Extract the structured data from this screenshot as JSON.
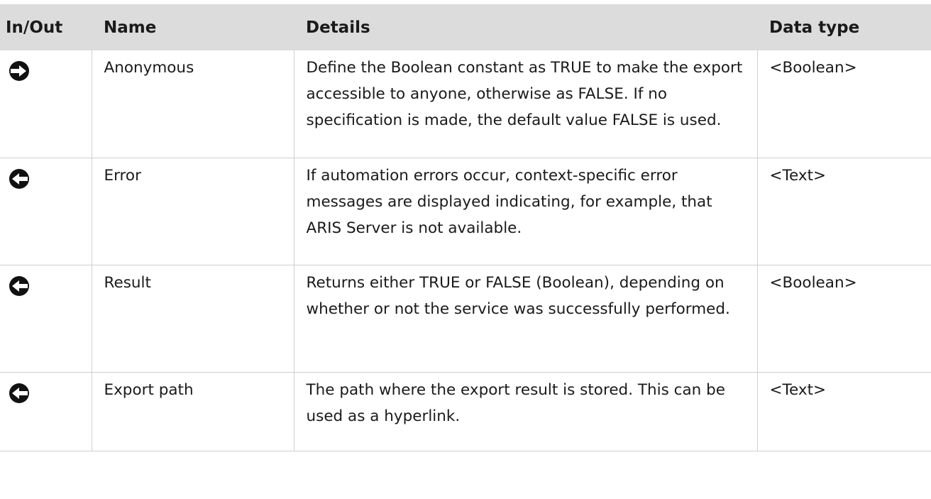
{
  "headers": {
    "inout": "In/Out",
    "name": "Name",
    "details": "Details",
    "datatype": "Data type"
  },
  "rows": [
    {
      "direction_icon": "input-arrow-icon",
      "name": "Anonymous",
      "details": "Define the Boolean constant as TRUE to make the export accessible to anyone, otherwise as FALSE. If no specification is made, the default value FALSE is used.",
      "datatype": "<Boolean>"
    },
    {
      "direction_icon": "output-arrow-icon",
      "name": "Error",
      "details": "If automation errors occur, context-specific error messages are displayed indicating, for example, that ARIS Server is not available.",
      "datatype": "<Text>"
    },
    {
      "direction_icon": "output-arrow-icon",
      "name": "Result",
      "details": "Returns either TRUE or FALSE (Boolean), depending on whether or not the service was successfully performed.",
      "datatype": "<Boolean>"
    },
    {
      "direction_icon": "output-arrow-icon",
      "name": "Export path",
      "details": "The path where the export result is stored. This can be used as a hyperlink.",
      "datatype": "<Text>"
    }
  ],
  "colors": {
    "header_bg": "#dcdcdc",
    "grid_line": "#cfcfcf",
    "text": "#1a1a1a"
  }
}
